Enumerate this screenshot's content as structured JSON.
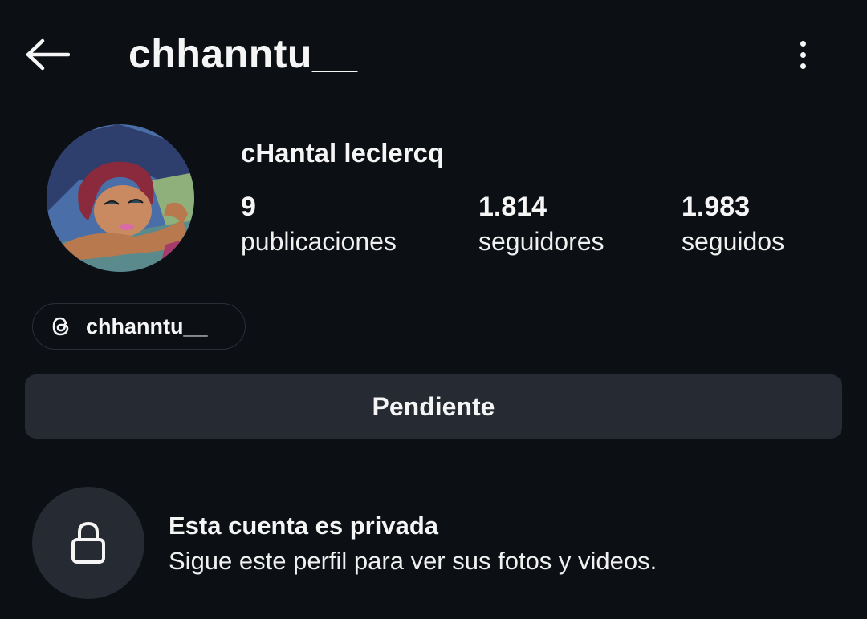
{
  "header": {
    "username": "chhanntu__",
    "back_icon": "arrow-left-icon",
    "more_icon": "vertical-ellipsis-icon"
  },
  "profile": {
    "full_name": "cHantal leclercq",
    "stats": {
      "posts": {
        "value": "9",
        "label": "publicaciones"
      },
      "followers": {
        "value": "1.814",
        "label": "seguidores"
      },
      "following": {
        "value": "1.983",
        "label": "seguidos"
      }
    },
    "threads": {
      "icon": "threads-icon",
      "handle": "chhanntu__"
    }
  },
  "actions": {
    "follow_status_label": "Pendiente"
  },
  "private_notice": {
    "icon": "lock-icon",
    "title": "Esta cuenta es privada",
    "description": "Sigue este perfil para ver sus fotos y videos."
  },
  "colors": {
    "background": "#0c0f14",
    "button_background": "#262a32",
    "text": "#f5f5f5"
  }
}
